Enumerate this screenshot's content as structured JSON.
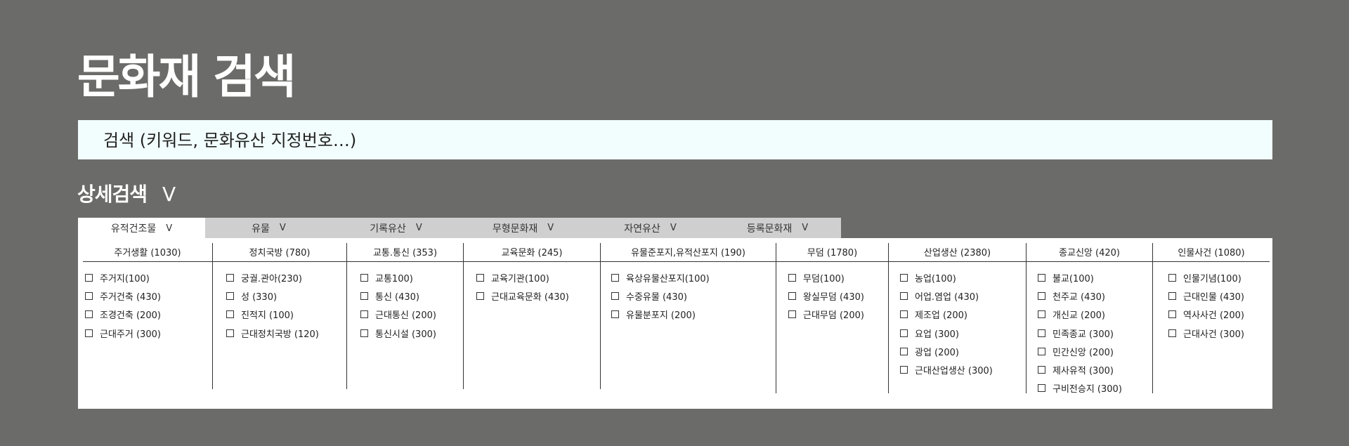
{
  "page": {
    "title": "문화재 검색"
  },
  "search": {
    "placeholder": "검색 (키워드, 문화유산 지정번호…)"
  },
  "advanced": {
    "label": "상세검색",
    "chevron": "V"
  },
  "tabs": [
    {
      "label": "유적건조물",
      "chevron": "V",
      "active": true
    },
    {
      "label": "유물",
      "chevron": "V"
    },
    {
      "label": "기록유산",
      "chevron": "V"
    },
    {
      "label": "무형문화재",
      "chevron": "V"
    },
    {
      "label": "자연유산",
      "chevron": "V"
    },
    {
      "label": "등록문화재",
      "chevron": "V"
    }
  ],
  "columns": [
    {
      "header": "주거생활 (1030)",
      "items": [
        "주거지(100)",
        "주거건축 (430)",
        "조경건축 (200)",
        "근대주거 (300)"
      ]
    },
    {
      "header": "정치국방 (780)",
      "items": [
        "궁궐.관아(230)",
        "성 (330)",
        "진적지 (100)",
        "근대정치국방 (120)"
      ]
    },
    {
      "header": "교통.통신 (353)",
      "items": [
        "교통100)",
        "통신 (430)",
        "근대통신 (200)",
        "통신시설 (300)"
      ]
    },
    {
      "header": "교육문화 (245)",
      "items": [
        "교육기관(100)",
        "근대교육문화 (430)"
      ]
    },
    {
      "header": "유물준포지,유적산포지 (190)",
      "items": [
        "육상유물산포지(100)",
        "수중유물 (430)",
        "유물분포지 (200)"
      ]
    },
    {
      "header": "무덤 (1780)",
      "items": [
        "무덤(100)",
        "왕실무덤 (430)",
        "근대무덤 (200)"
      ]
    },
    {
      "header": "산업생산 (2380)",
      "items": [
        "농업(100)",
        "어업.염업 (430)",
        "제조업 (200)",
        "요업 (300)",
        "광업 (200)",
        "근대산업생산 (300)"
      ]
    },
    {
      "header": "종교신앙 (420)",
      "items": [
        "불교(100)",
        "천주교 (430)",
        "개신교 (200)",
        "민족종교 (300)",
        "민간신앙 (200)",
        "제사유적 (300)",
        "구비전승지 (300)"
      ]
    },
    {
      "header": "인물사건 (1080)",
      "items": [
        "인물기념(100)",
        "근대인물 (430)",
        "역사사건 (200)",
        "근대사건 (300)"
      ]
    }
  ]
}
